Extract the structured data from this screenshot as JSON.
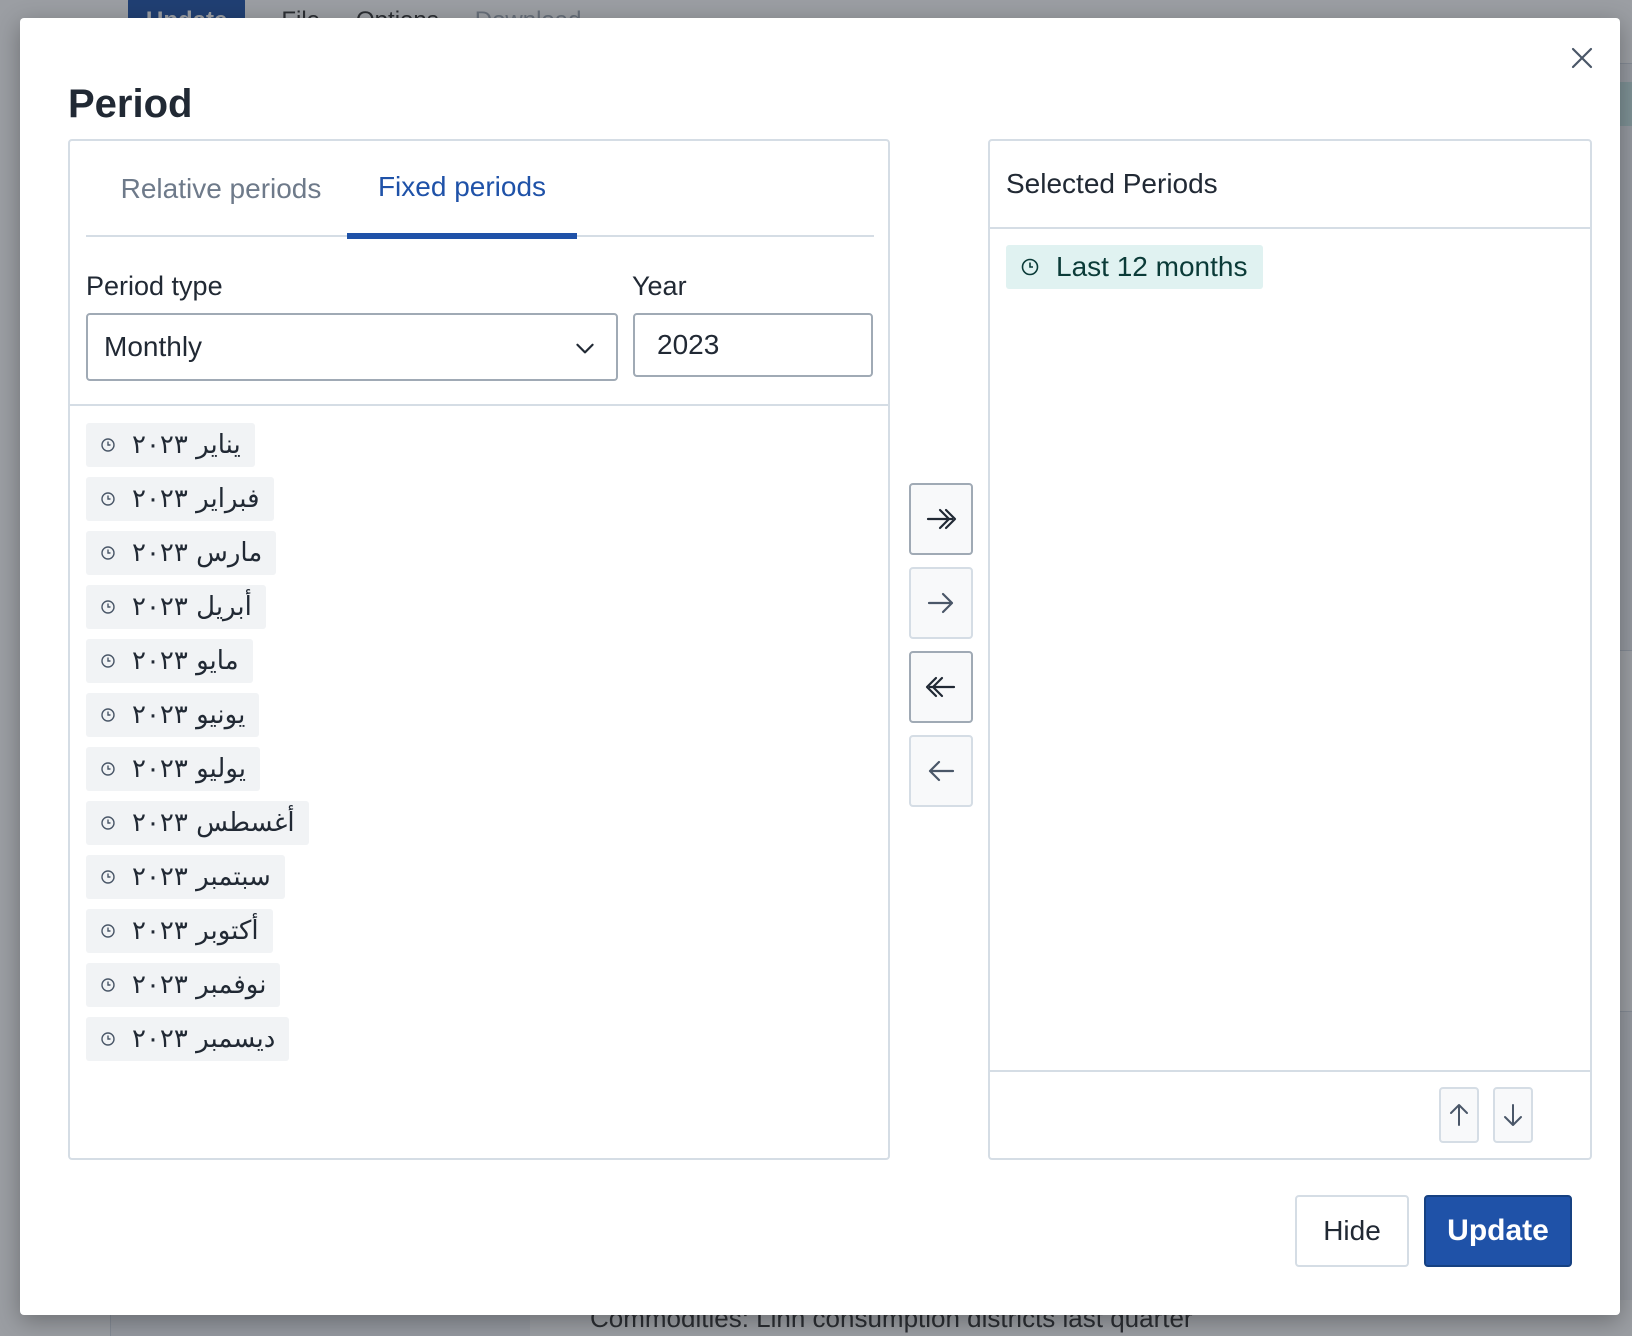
{
  "background": {
    "update_label": "Update",
    "menu": [
      "File",
      "Options",
      "Download"
    ],
    "strip_text": "Commodities: Linn consumption districts last quarter"
  },
  "modal": {
    "title": "Period",
    "close_icon": "close-icon",
    "tabs": [
      {
        "label": "Relative periods",
        "active": false
      },
      {
        "label": "Fixed periods",
        "active": true
      }
    ],
    "period_type": {
      "label": "Period type",
      "value": "Monthly"
    },
    "year": {
      "label": "Year",
      "value": "2023"
    },
    "available_periods": [
      "يناير ٢٠٢٣",
      "فبراير ٢٠٢٣",
      "مارس ٢٠٢٣",
      "أبريل ٢٠٢٣",
      "مايو ٢٠٢٣",
      "يونيو ٢٠٢٣",
      "يوليو ٢٠٢٣",
      "أغسطس ٢٠٢٣",
      "سبتمبر ٢٠٢٣",
      "أكتوبر ٢٠٢٣",
      "نوفمبر ٢٠٢٣",
      "ديسمبر ٢٠٢٣"
    ],
    "selected": {
      "title": "Selected Periods",
      "items": [
        "Last 12 months"
      ]
    },
    "buttons": {
      "hide": "Hide",
      "update": "Update"
    }
  },
  "colors": {
    "primary": "#1f52a8",
    "selected_chip_bg": "#e0f2f1",
    "chip_bg": "#f1f3f5",
    "border": "#d5dde5"
  }
}
